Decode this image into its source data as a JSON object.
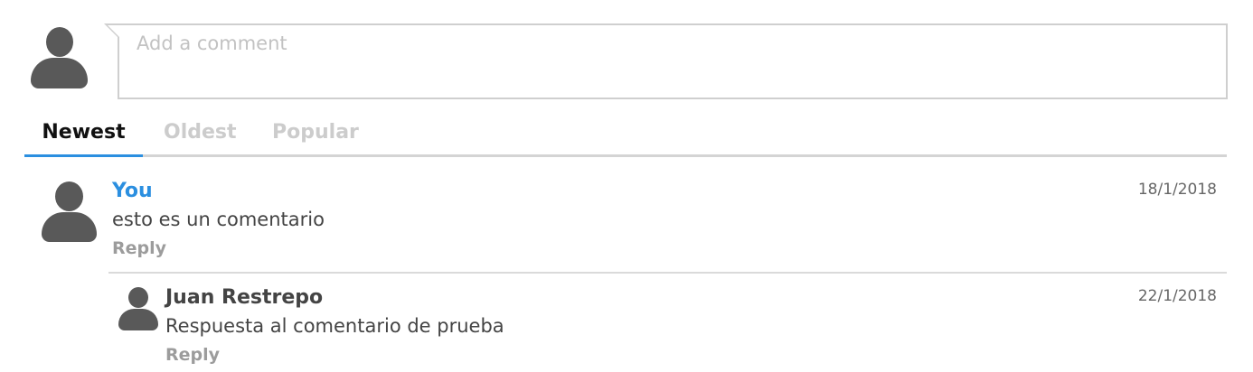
{
  "composer": {
    "placeholder": "Add a comment",
    "avatar_icon": "user-silhouette-icon"
  },
  "sort_tabs": {
    "active": "Newest",
    "items": [
      {
        "label": "Newest"
      },
      {
        "label": "Oldest"
      },
      {
        "label": "Popular"
      }
    ]
  },
  "comments": [
    {
      "author": "You",
      "text": "esto es un comentario",
      "date": "18/1/2018",
      "reply_label": "Reply",
      "replies": [
        {
          "author": "Juan Restrepo",
          "text": "Respuesta al comentario de prueba",
          "date": "22/1/2018",
          "reply_label": "Reply"
        }
      ]
    }
  ],
  "colors": {
    "accent": "#2b8fe0",
    "avatar": "#595959",
    "muted": "#cccccc",
    "border": "#cfcfcf"
  }
}
